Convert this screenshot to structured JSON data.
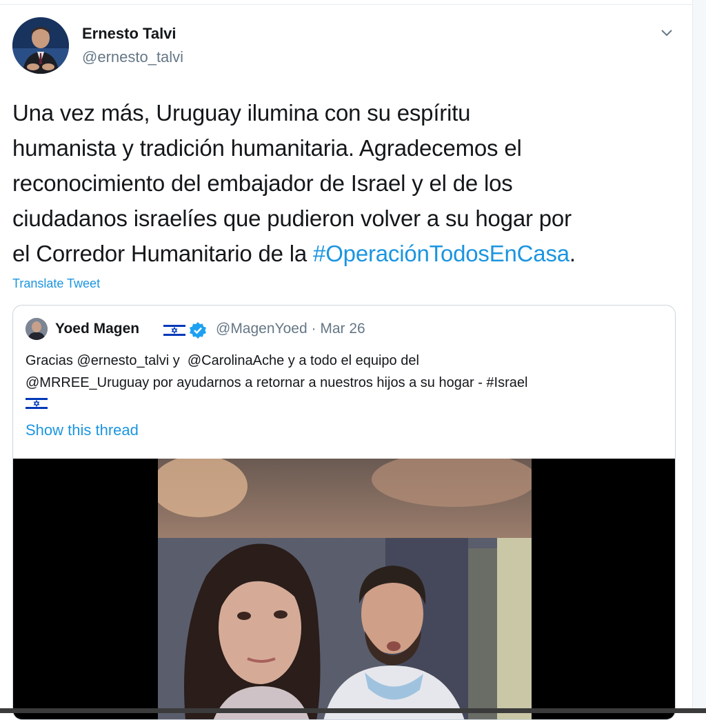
{
  "tweet": {
    "author": {
      "display_name": "Ernesto Talvi",
      "handle": "@ernesto_talvi"
    },
    "text_lines": [
      "Una vez más, Uruguay ilumina con su espíritu",
      "humanista y tradición humanitaria. Agradecemos el",
      "reconocimiento del embajador de Israel y el de los",
      "ciudadanos israelíes que pudieron volver a su hogar por",
      "el Corredor Humanitario de la "
    ],
    "hashtag": "#OperaciónTodosEnCasa",
    "text_end": ".",
    "translate_label": "Translate Tweet",
    "menu_icon": "chevron-down-icon"
  },
  "quoted_tweet": {
    "author": {
      "display_name": "Yoed Magen",
      "handle": "@MagenYoed",
      "separator": " · ",
      "date": "Mar 26"
    },
    "icons": {
      "flag": "israel-flag-icon",
      "verified": "verified-badge-icon"
    },
    "text_lines": [
      "Gracias @ernesto_talvi y  @CarolinaAche y a todo el equipo del",
      "@MRREE_Uruguay por ayudarnos a retornar a nuestros hijos a su hogar - #Israel"
    ],
    "show_thread_label": "Show this thread",
    "media": {
      "type": "video"
    }
  },
  "colors": {
    "link": "#1b95e0",
    "text": "#14171a",
    "secondary": "#657786",
    "border": "#ccd6dd",
    "verified": "#1da1f2",
    "flag_blue": "#0038b8"
  }
}
